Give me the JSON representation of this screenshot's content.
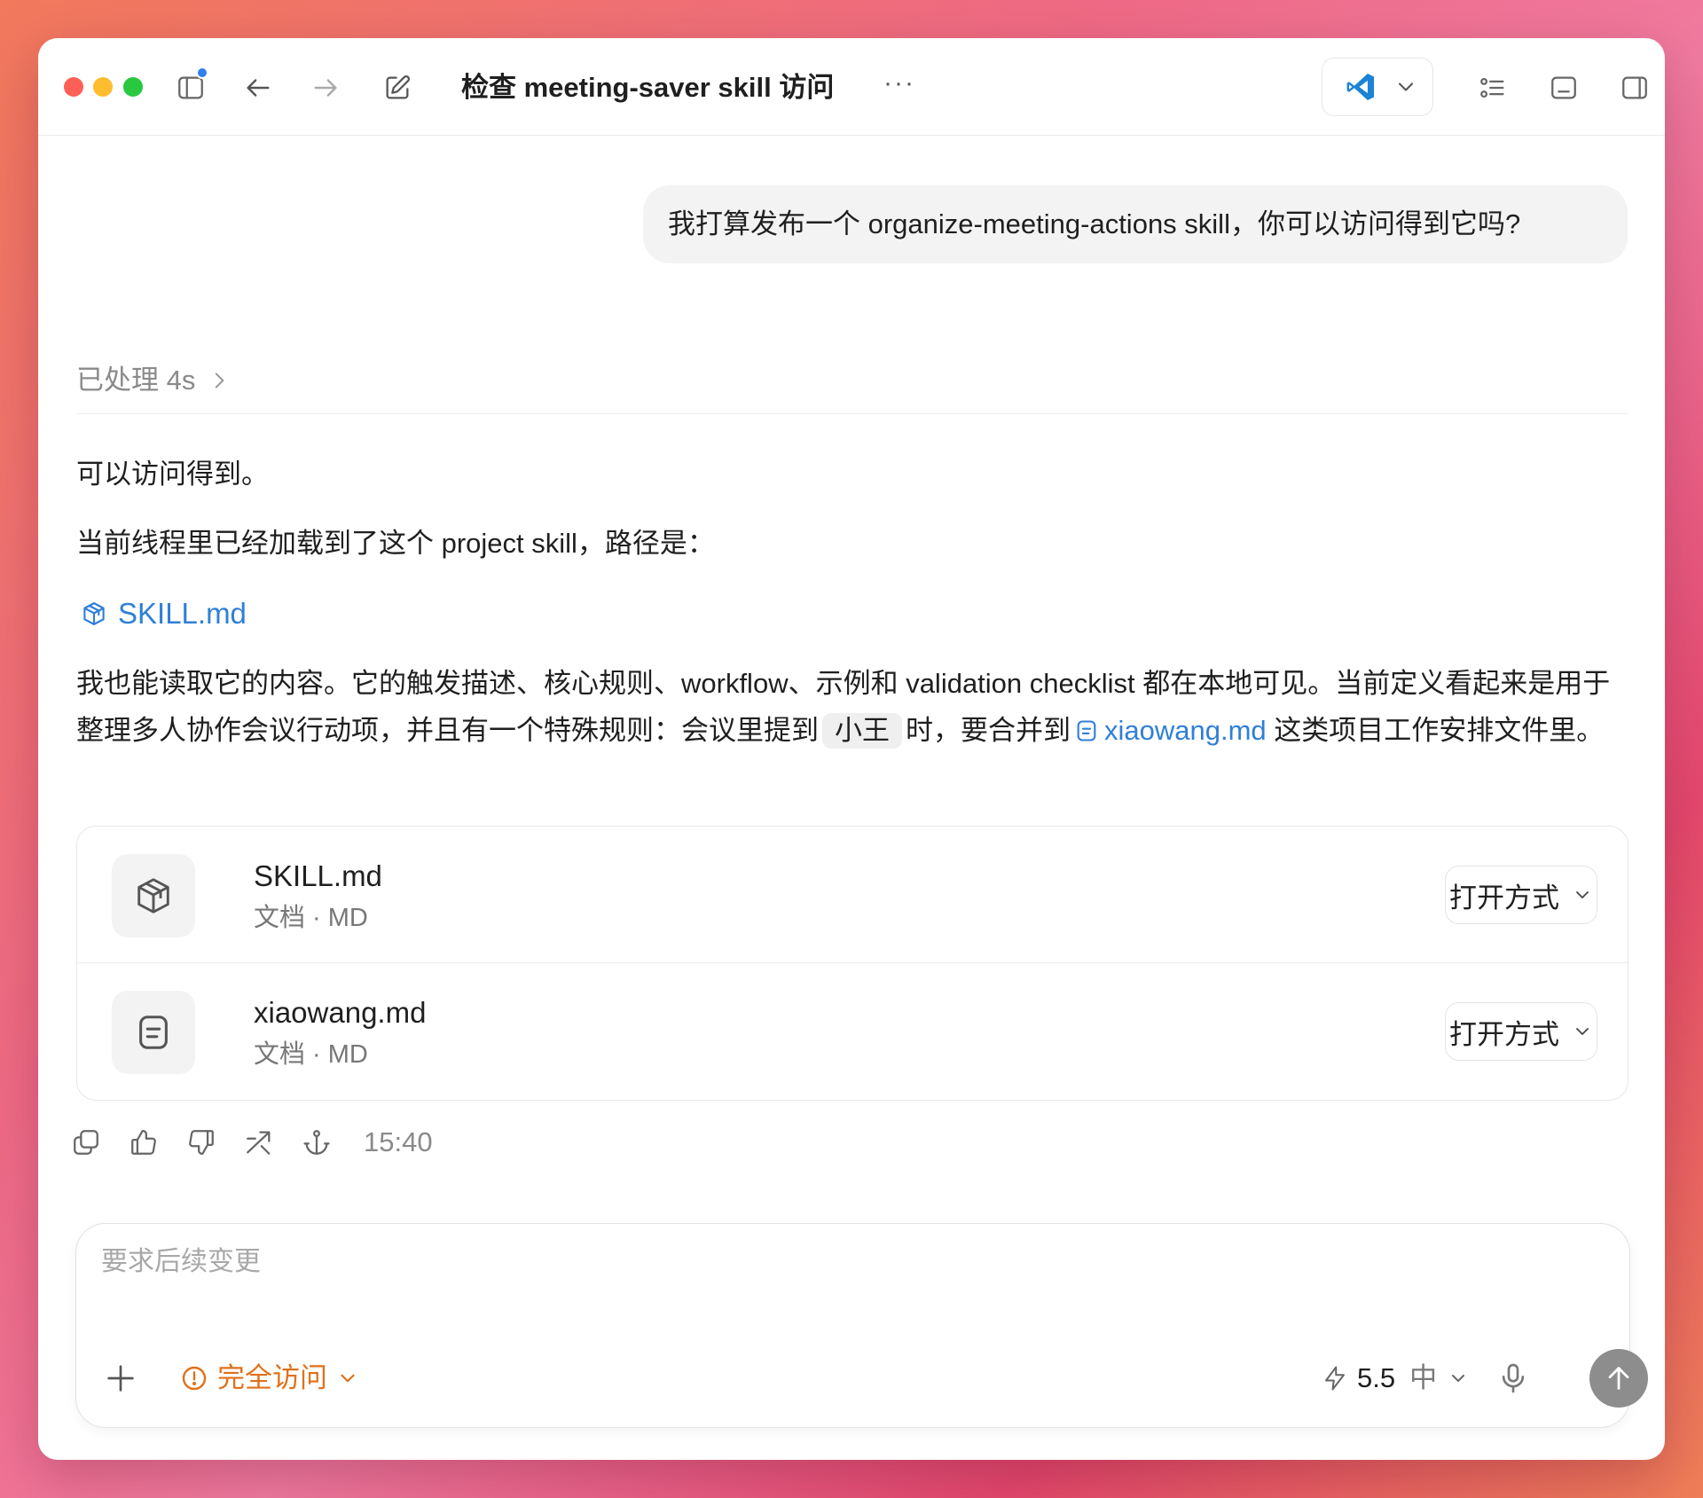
{
  "titlebar": {
    "title": "检查 meeting-saver skill 访问",
    "more": "···",
    "icons": [
      "sidebar-toggle-icon",
      "back-arrow-icon",
      "forward-arrow-icon",
      "compose-icon",
      "vscode-icon",
      "chevron-down-icon",
      "task-list-icon",
      "bottom-panel-icon",
      "right-panel-icon"
    ],
    "notification_color": "#2f80ed"
  },
  "conversation": {
    "user_message": "我打算发布一个 organize-meeting-actions skill，你可以访问得到它吗?",
    "processed_label": "已处理 4s",
    "reply": {
      "line1": "可以访问得到。",
      "line2": "当前线程里已经加载到了这个 project skill，路径是：",
      "skill_link": "SKILL.md",
      "p3_part1": "我也能读取它的内容。它的触发描述、核心规则、workflow、示例和 validation checklist 都在本地可见。当前定义看起来是用于整理多人协作会议行动项，并且有一个特殊规则：会议里提到",
      "p3_chip": "小王",
      "p3_part2": "时，要合并到",
      "p3_link": "xiaowang.md",
      "p3_part3": "这类项目工作安排文件里。"
    },
    "files": [
      {
        "name": "SKILL.md",
        "meta": "文档 · MD",
        "open_label": "打开方式",
        "icon": "cube-icon"
      },
      {
        "name": "xiaowang.md",
        "meta": "文档 · MD",
        "open_label": "打开方式",
        "icon": "document-icon"
      }
    ],
    "actions": {
      "icons": [
        "copy-icon",
        "thumbs-up-icon",
        "thumbs-down-icon",
        "fork-icon",
        "anchor-icon"
      ],
      "time": "15:40"
    }
  },
  "composer": {
    "placeholder": "要求后续变更",
    "access_label": "完全访问",
    "model_version": "5.5",
    "model_level": "中",
    "access_color": "#e0701a",
    "link_color": "#2f7fd8"
  }
}
